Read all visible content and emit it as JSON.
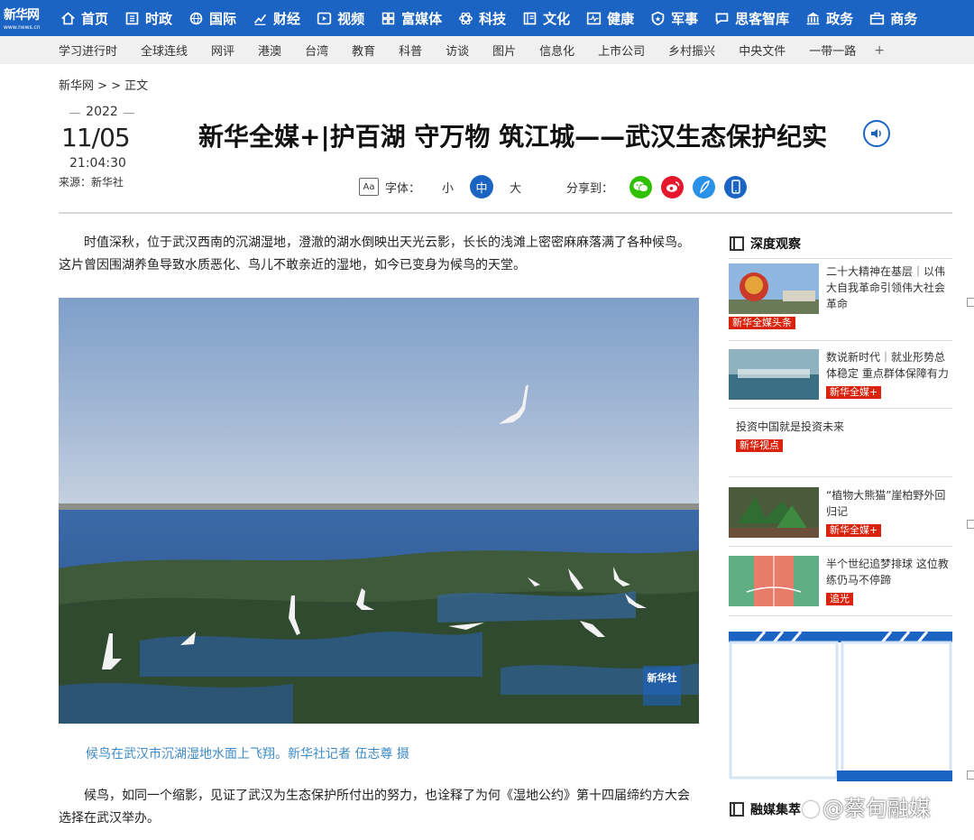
{
  "logo": {
    "text": "新华网",
    "sub": "www.news.cn"
  },
  "nav": [
    {
      "label": "首页",
      "icon": "home-icon"
    },
    {
      "label": "时政",
      "icon": "building-icon"
    },
    {
      "label": "国际",
      "icon": "globe-icon"
    },
    {
      "label": "财经",
      "icon": "chart-icon"
    },
    {
      "label": "视频",
      "icon": "play-icon"
    },
    {
      "label": "富媒体",
      "icon": "grid-icon"
    },
    {
      "label": "科技",
      "icon": "atom-icon"
    },
    {
      "label": "文化",
      "icon": "book-icon"
    },
    {
      "label": "健康",
      "icon": "pulse-icon"
    },
    {
      "label": "军事",
      "icon": "shield-icon"
    },
    {
      "label": "思客智库",
      "icon": "chat-icon"
    },
    {
      "label": "政务",
      "icon": "institution-icon"
    },
    {
      "label": "商务",
      "icon": "briefcase-icon"
    }
  ],
  "subnav": [
    "学习进行时",
    "全球连线",
    "网评",
    "港澳",
    "台湾",
    "教育",
    "科普",
    "访谈",
    "图片",
    "信息化",
    "上市公司",
    "乡村振兴",
    "中央文件",
    "一带一路"
  ],
  "subnav_more": "+",
  "breadcrumb": "新华网 > > 正文",
  "article": {
    "year": "2022",
    "date": "11/05",
    "time": "21:04:30",
    "source": "来源：新华社",
    "title": "新华全媒+|护百湖 守万物 筑江城——武汉生态保护纪实",
    "font_label": "字体：",
    "font_small": "小",
    "font_medium": "中",
    "font_large": "大",
    "aa_icon": "Aa",
    "share_label": "分享到：",
    "para1": "时值深秋，位于武汉西南的沉湖湿地，澄澈的湖水倒映出天光云影，长长的浅滩上密密麻麻落满了各种候鸟。这片曾因围湖养鱼导致水质恶化、鸟儿不敢亲近的湿地，如今已变身为候鸟的天堂。",
    "photo_watermark": "新华社",
    "caption": "候鸟在武汉市沉湖湿地水面上飞翔。新华社记者 伍志尊 摄",
    "para2": "候鸟，如同一个缩影，见证了武汉为生态保护所付出的努力，也诠释了为何《湿地公约》第十四届缔约方大会选择在武汉举办。"
  },
  "sidebar": {
    "heading1": "深度观察",
    "items": [
      {
        "text": "二十大精神在基层｜以伟大自我革命引领伟大社会革命",
        "tag": "新华全媒头条"
      },
      {
        "text": "数说新时代｜就业形势总体稳定 重点群体保障有力",
        "tag": "新华全媒+"
      },
      {
        "text": "投资中国就是投资未来",
        "tag": "新华视点"
      },
      {
        "text": "“植物大熊猫”崖柏野外回归记",
        "tag": "新华全媒+"
      },
      {
        "text": "半个世纪追梦排球 这位教练仍马不停蹄",
        "tag": "追光"
      }
    ],
    "heading2": "融媒集萃"
  },
  "watermark": "@蔡甸融媒",
  "colors": {
    "brand_blue": "#1c64c4",
    "tag_red": "#d9230d",
    "caption_blue": "#3e8bc6"
  }
}
